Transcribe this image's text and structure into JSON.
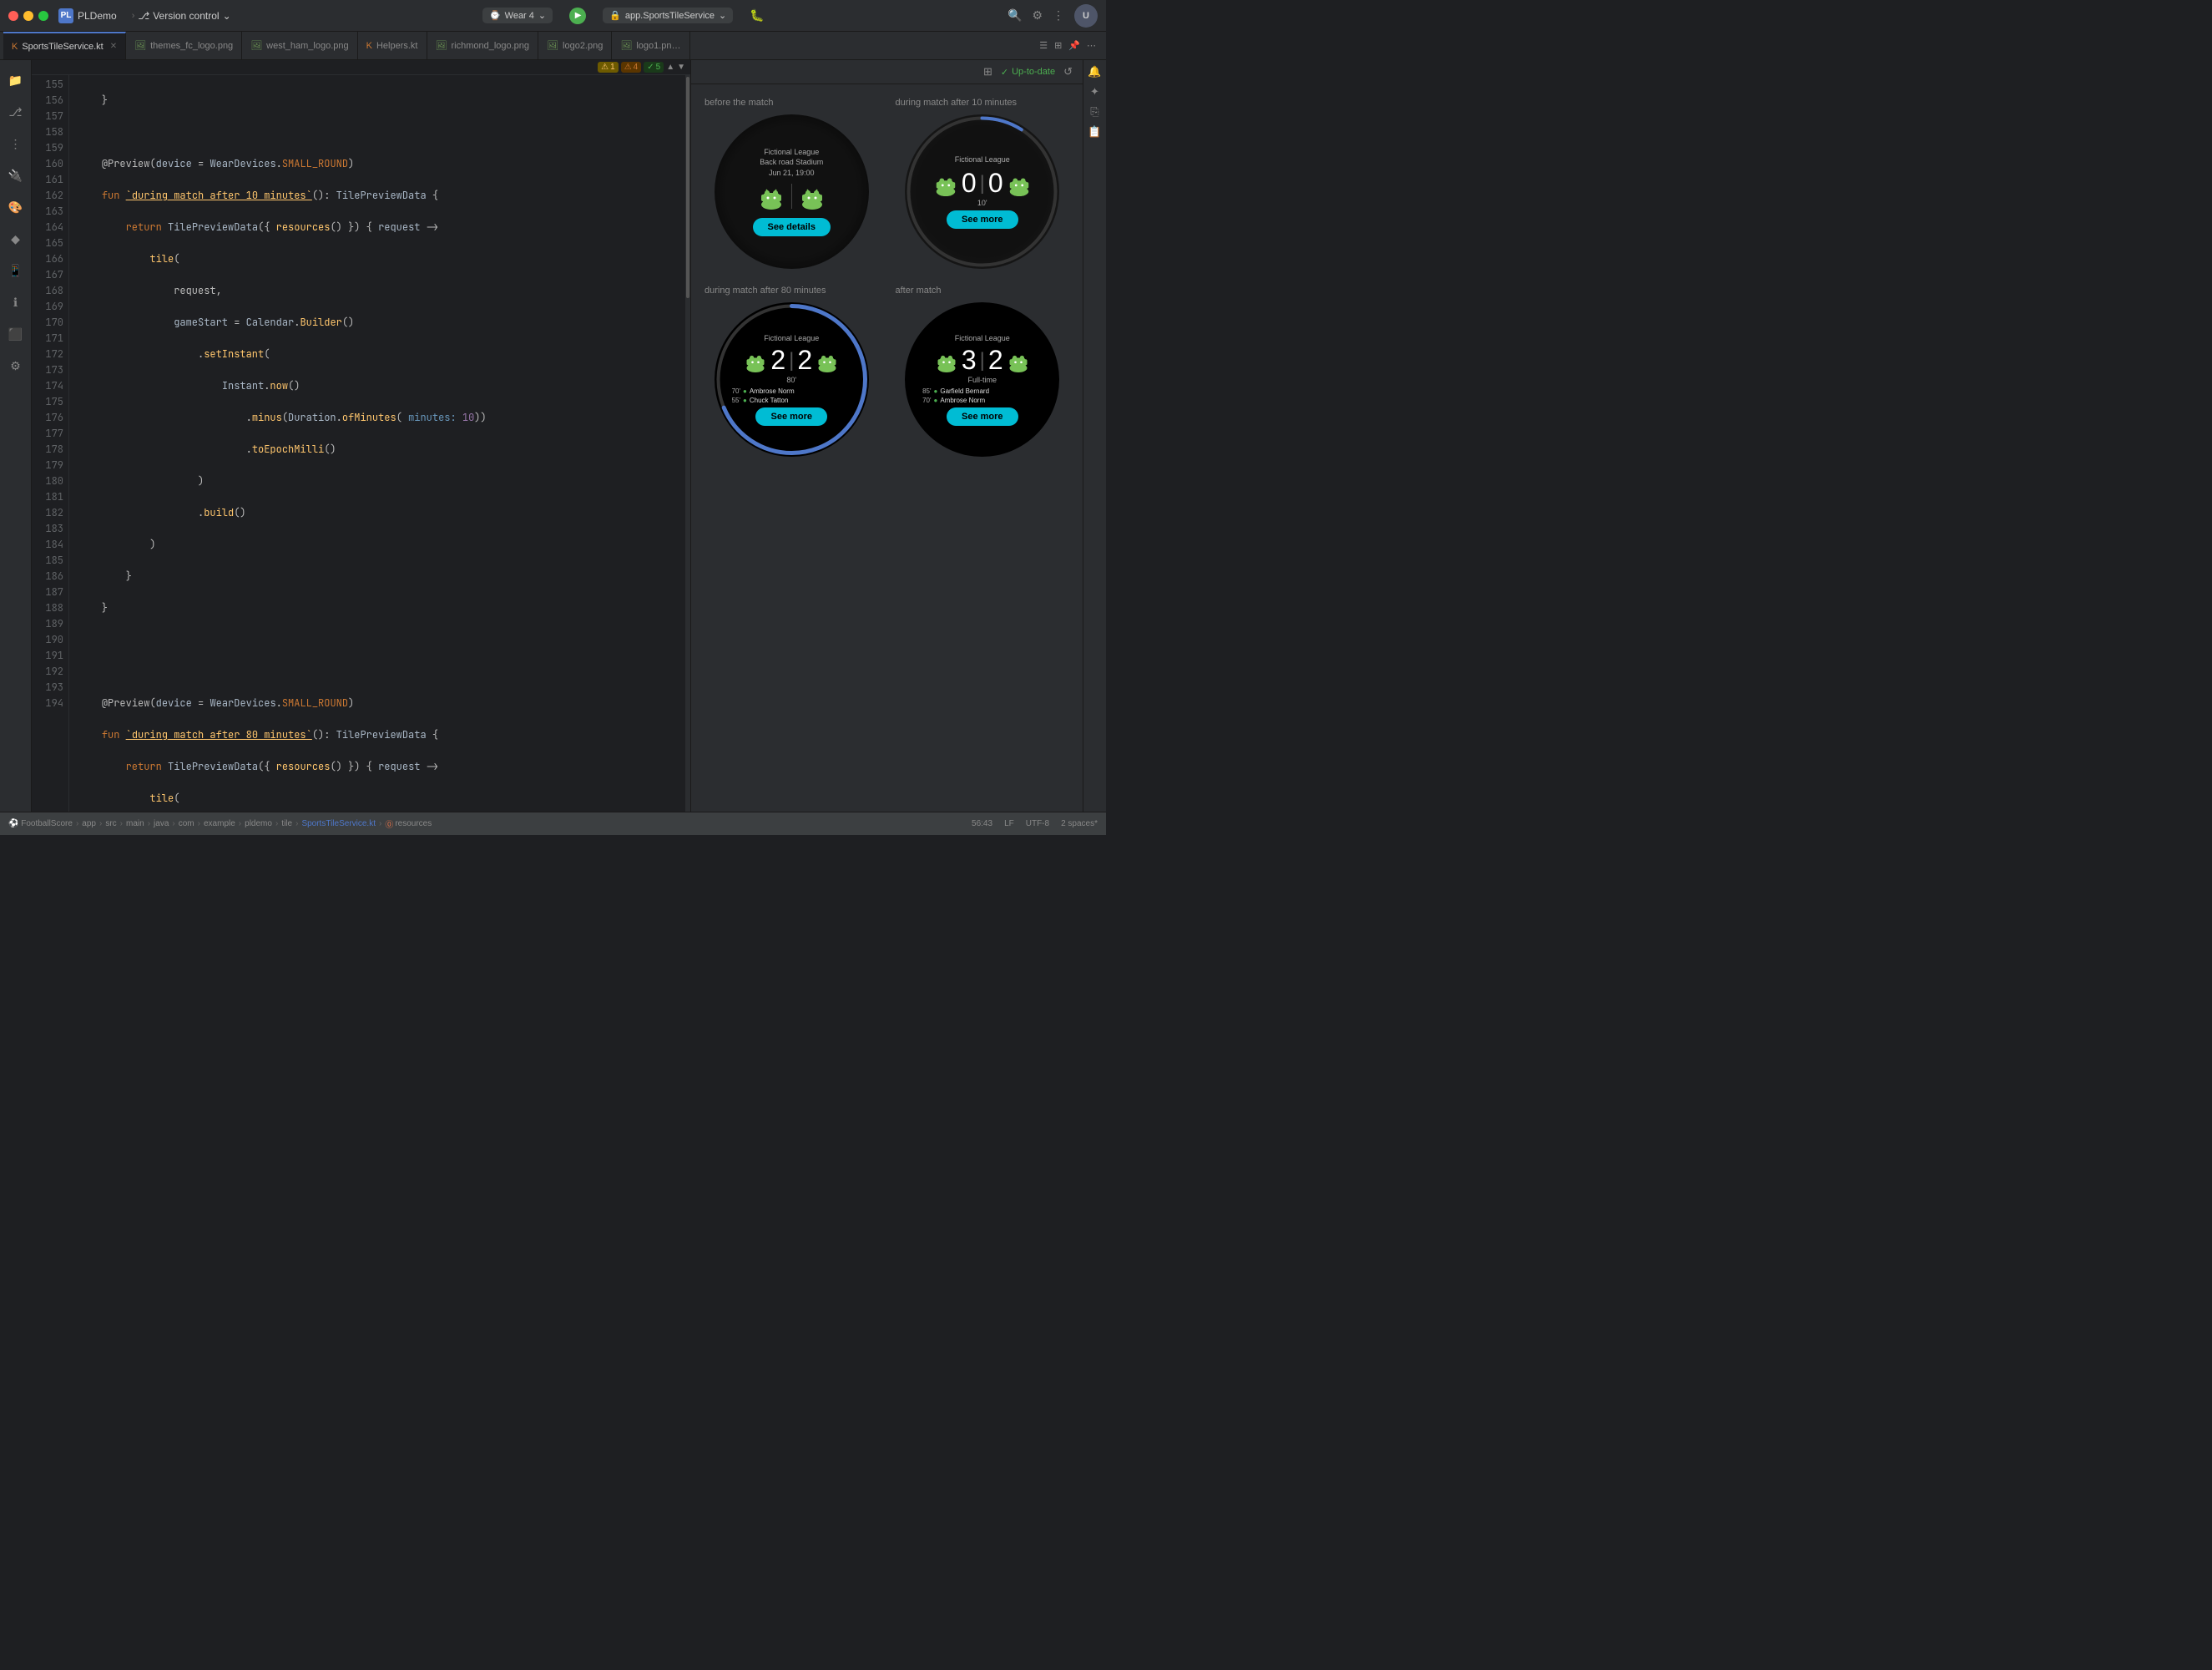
{
  "titlebar": {
    "app_name": "PLDemo",
    "version_control": "Version control",
    "device": "Wear 4",
    "service": "app.SportsTileService",
    "run_label": "Run",
    "debug_label": "Debug"
  },
  "tabs": [
    {
      "label": "SportsTileService.kt",
      "type": "kt",
      "active": true
    },
    {
      "label": "themes_fc_logo.png",
      "type": "png",
      "active": false
    },
    {
      "label": "west_ham_logo.png",
      "type": "png",
      "active": false
    },
    {
      "label": "Helpers.kt",
      "type": "kt",
      "active": false
    },
    {
      "label": "richmond_logo.png",
      "type": "png",
      "active": false
    },
    {
      "label": "logo2.png",
      "type": "png",
      "active": false
    },
    {
      "label": "logo1.pn…",
      "type": "png",
      "active": false
    }
  ],
  "editor": {
    "warnings": {
      "w1": "1",
      "w2": "4",
      "w3": "5"
    },
    "lines": [
      {
        "num": "155",
        "code": "    }"
      },
      {
        "num": "156",
        "code": ""
      },
      {
        "num": "157",
        "code": "    @Preview(device = WearDevices.SMALL_ROUND)"
      },
      {
        "num": "158",
        "code": "    fun `during match after 10 minutes`(): TilePreviewData {"
      },
      {
        "num": "159",
        "code": "        return TilePreviewData({ resources() }) { request ->"
      },
      {
        "num": "160",
        "code": "            tile("
      },
      {
        "num": "161",
        "code": "                request,"
      },
      {
        "num": "162",
        "code": "                gameStart = Calendar.Builder()"
      },
      {
        "num": "163",
        "code": "                    .setInstant("
      },
      {
        "num": "164",
        "code": "                        Instant.now()"
      },
      {
        "num": "165",
        "code": "                            .minus(Duration.ofMinutes( minutes: 10))"
      },
      {
        "num": "166",
        "code": "                            .toEpochMilli()"
      },
      {
        "num": "167",
        "code": "                    )"
      },
      {
        "num": "168",
        "code": "                    .build()"
      },
      {
        "num": "169",
        "code": "            )"
      },
      {
        "num": "170",
        "code": "        }"
      },
      {
        "num": "171",
        "code": "    }"
      },
      {
        "num": "172",
        "code": ""
      },
      {
        "num": "173",
        "code": ""
      },
      {
        "num": "174",
        "code": "    @Preview(device = WearDevices.SMALL_ROUND)"
      },
      {
        "num": "175",
        "code": "    fun `during match after 80 minutes`(): TilePreviewData {"
      },
      {
        "num": "176",
        "code": "        return TilePreviewData({ resources() }) { request ->"
      },
      {
        "num": "177",
        "code": "            tile("
      },
      {
        "num": "178",
        "code": "                request,"
      },
      {
        "num": "179",
        "code": "                gameStart = Calendar.Builder()"
      },
      {
        "num": "180",
        "code": "                    .setInstant("
      },
      {
        "num": "181",
        "code": "                        Instant.now()"
      },
      {
        "num": "182",
        "code": "                            .minus(Duration.ofMinutes( minutes: 80))"
      },
      {
        "num": "183",
        "code": "                            .toEpochMilli()"
      },
      {
        "num": "184",
        "code": "                    )"
      },
      {
        "num": "185",
        "code": "                    .build()"
      },
      {
        "num": "186",
        "code": "            )"
      },
      {
        "num": "187",
        "code": "        }"
      },
      {
        "num": "188",
        "code": "    }"
      },
      {
        "num": "189",
        "code": ""
      },
      {
        "num": "190",
        "code": ""
      },
      {
        "num": "191",
        "code": "    @Preview(device = WearDevices.SMALL_ROUND)"
      },
      {
        "num": "192",
        "code": "    fun `after match`(): TilePreviewData {"
      },
      {
        "num": "193",
        "code": "        return TilePreviewData({ resources() }) { request ->"
      },
      {
        "num": "194",
        "code": "            tile("
      }
    ]
  },
  "preview": {
    "status": "Up-to-date",
    "sections": [
      {
        "id": "before-match",
        "label": "before the match",
        "league": "Fictional League\nBack road Stadium\nJun 21, 19:00",
        "score": null,
        "button": "See details",
        "button_type": "details"
      },
      {
        "id": "during-10",
        "label": "during match after 10 minutes",
        "league": "Fictional League",
        "score_home": "0",
        "score_away": "0",
        "minute": "10'",
        "button": "See more",
        "button_type": "more"
      },
      {
        "id": "during-80",
        "label": "during match after 80 minutes",
        "league": "Fictional League",
        "score_home": "2",
        "score_away": "2",
        "minute": "80'",
        "scorers": [
          {
            "min": "70'",
            "name": "Ambrose Norm"
          },
          {
            "min": "55'",
            "name": "Chuck Tatton"
          }
        ],
        "button": "See more",
        "button_type": "more"
      },
      {
        "id": "after-match",
        "label": "after match",
        "league": "Fictional League",
        "score_home": "3",
        "score_away": "2",
        "minute": "Full-time",
        "scorers": [
          {
            "min": "85'",
            "name": "Garfield Bernard"
          },
          {
            "min": "70'",
            "name": "Ambrose Norm"
          }
        ],
        "button": "See more",
        "button_type": "more"
      }
    ]
  },
  "statusbar": {
    "breadcrumbs": [
      "FootballScore",
      "app",
      "src",
      "main",
      "java",
      "com",
      "example",
      "pldemo",
      "tile",
      "SportsTileService.kt",
      "resources"
    ],
    "position": "56:43",
    "encoding": "LF",
    "charset": "UTF-8",
    "indent": "2 spaces*"
  },
  "sidebar": {
    "items": [
      "folder",
      "git",
      "more",
      "plugin",
      "settings",
      "notification"
    ]
  }
}
